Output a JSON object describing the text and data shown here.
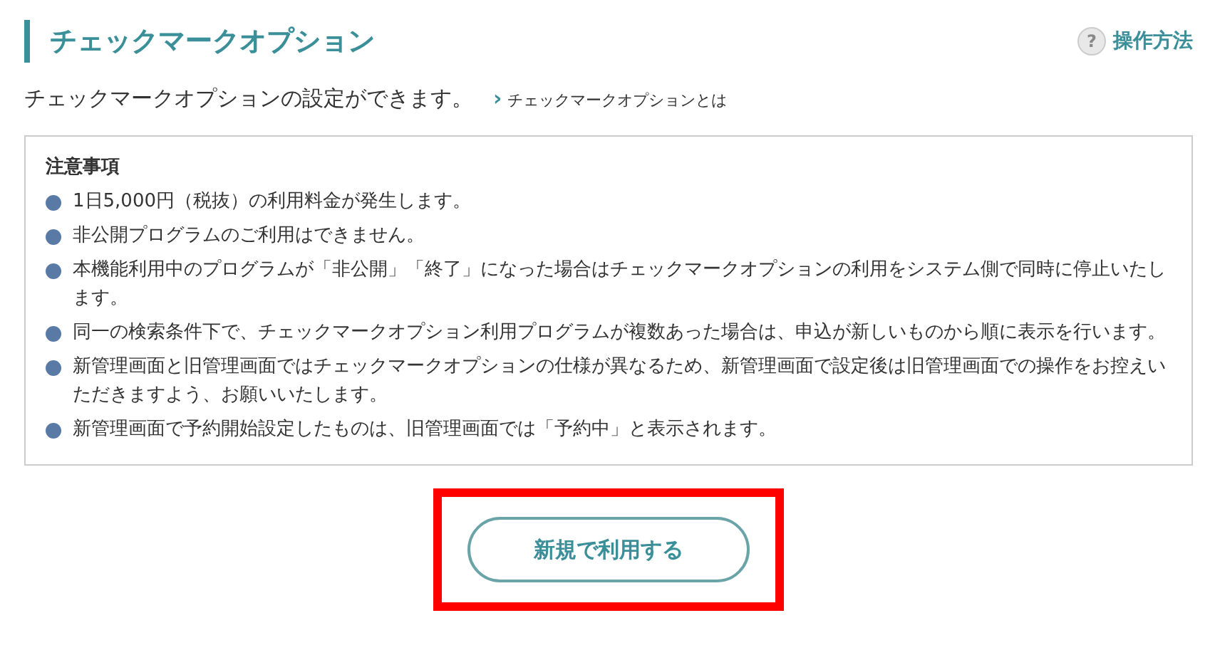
{
  "header": {
    "title": "チェックマークオプション",
    "help_icon": "?",
    "help_link": "操作方法"
  },
  "description": {
    "text": "チェックマークオプションの設定ができます。",
    "link_arrow": "›",
    "link": "チェックマークオプションとは"
  },
  "notice": {
    "title": "注意事項",
    "items": [
      "1日5,000円（税抜）の利用料金が発生します。",
      "非公開プログラムのご利用はできません。",
      "本機能利用中のプログラムが「非公開」「終了」になった場合はチェックマークオプションの利用をシステム側で同時に停止いたします。",
      "同一の検索条件下で、チェックマークオプション利用プログラムが複数あった場合は、申込が新しいものから順に表示を行います。",
      "新管理画面と旧管理画面ではチェックマークオプションの仕様が異なるため、新管理画面で設定後は旧管理画面での操作をお控えいただきますよう、お願いいたします。",
      "新管理画面で予約開始設定したものは、旧管理画面では「予約中」と表示されます。"
    ]
  },
  "button": {
    "label": "新規で利用する",
    "highlighted": true
  }
}
